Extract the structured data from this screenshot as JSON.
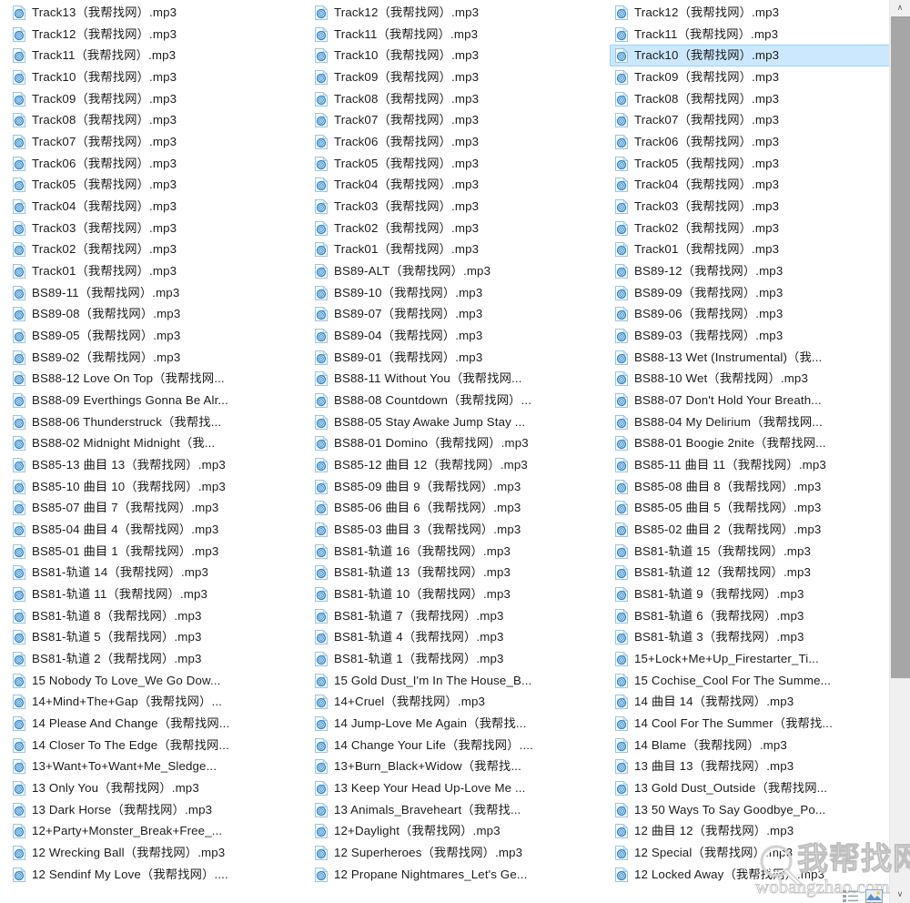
{
  "window": {
    "view_mode": "list",
    "accent_selection_color": "#cce8ff",
    "selection_border_color": "#99d1ff",
    "text_color": "#1c1c1c",
    "background_color": "#ffffff"
  },
  "scrollbar": {
    "up_arrow": "∧",
    "down_arrow": "∨",
    "thumb_color": "#a6a6a6",
    "track_color": "#f0f0f0"
  },
  "watermark": {
    "chinese_text": "我帮找网",
    "url_text": "wobangzhao.com"
  },
  "selected_file": "Track10（我帮找网）.mp3",
  "columns": [
    {
      "index": 1,
      "files": [
        "Track13（我帮找网）.mp3",
        "Track12（我帮找网）.mp3",
        "Track11（我帮找网）.mp3",
        "Track10（我帮找网）.mp3",
        "Track09（我帮找网）.mp3",
        "Track08（我帮找网）.mp3",
        "Track07（我帮找网）.mp3",
        "Track06（我帮找网）.mp3",
        "Track05（我帮找网）.mp3",
        "Track04（我帮找网）.mp3",
        "Track03（我帮找网）.mp3",
        "Track02（我帮找网）.mp3",
        "Track01（我帮找网）.mp3",
        "BS89-11（我帮找网）.mp3",
        "BS89-08（我帮找网）.mp3",
        "BS89-05（我帮找网）.mp3",
        "BS89-02（我帮找网）.mp3",
        "BS88-12 Love On Top（我帮找网...",
        "BS88-09 Everthings Gonna Be Alr...",
        "BS88-06 Thunderstruck（我帮找...",
        "BS88-02 Midnight Midnight（我...",
        "BS85-13 曲目 13（我帮找网）.mp3",
        "BS85-10 曲目 10（我帮找网）.mp3",
        "BS85-07 曲目 7（我帮找网）.mp3",
        "BS85-04 曲目 4（我帮找网）.mp3",
        "BS85-01 曲目 1（我帮找网）.mp3",
        "BS81-轨道 14（我帮找网）.mp3",
        "BS81-轨道 11（我帮找网）.mp3",
        "BS81-轨道 8（我帮找网）.mp3",
        "BS81-轨道 5（我帮找网）.mp3",
        "BS81-轨道 2（我帮找网）.mp3",
        "15 Nobody To Love_We Go Dow...",
        "14+Mind+The+Gap（我帮找网）...",
        "14 Please And Change（我帮找网...",
        "14 Closer To The Edge（我帮找网...",
        "13+Want+To+Want+Me_Sledge...",
        "13 Only You（我帮找网）.mp3",
        "13 Dark Horse（我帮找网）.mp3",
        "12+Party+Monster_Break+Free_...",
        "12 Wrecking Ball（我帮找网）.mp3",
        "12 Sendinf My Love（我帮找网）...."
      ]
    },
    {
      "index": 2,
      "files": [
        "Track12（我帮找网）.mp3",
        "Track11（我帮找网）.mp3",
        "Track10（我帮找网）.mp3",
        "Track09（我帮找网）.mp3",
        "Track08（我帮找网）.mp3",
        "Track07（我帮找网）.mp3",
        "Track06（我帮找网）.mp3",
        "Track05（我帮找网）.mp3",
        "Track04（我帮找网）.mp3",
        "Track03（我帮找网）.mp3",
        "Track02（我帮找网）.mp3",
        "Track01（我帮找网）.mp3",
        "BS89-ALT（我帮找网）.mp3",
        "BS89-10（我帮找网）.mp3",
        "BS89-07（我帮找网）.mp3",
        "BS89-04（我帮找网）.mp3",
        "BS89-01（我帮找网）.mp3",
        "BS88-11 Without You（我帮找网...",
        "BS88-08 Countdown（我帮找网）...",
        "BS88-05 Stay Awake Jump Stay ...",
        "BS88-01 Domino（我帮找网）.mp3",
        "BS85-12 曲目 12（我帮找网）.mp3",
        "BS85-09 曲目 9（我帮找网）.mp3",
        "BS85-06 曲目 6（我帮找网）.mp3",
        "BS85-03 曲目 3（我帮找网）.mp3",
        "BS81-轨道 16（我帮找网）.mp3",
        "BS81-轨道 13（我帮找网）.mp3",
        "BS81-轨道 10（我帮找网）.mp3",
        "BS81-轨道 7（我帮找网）.mp3",
        "BS81-轨道 4（我帮找网）.mp3",
        "BS81-轨道 1（我帮找网）.mp3",
        "15 Gold Dust_I'm In The House_B...",
        "14+Cruel（我帮找网）.mp3",
        "14 Jump-Love Me Again（我帮找...",
        "14 Change Your Life（我帮找网）....",
        "13+Burn_Black+Widow（我帮找...",
        "13 Keep Your Head Up-Love Me ...",
        "13 Animals_Braveheart（我帮找...",
        "12+Daylight（我帮找网）.mp3",
        "12 Superheroes（我帮找网）.mp3",
        "12 Propane Nightmares_Let's Ge..."
      ]
    },
    {
      "index": 3,
      "files": [
        "Track12（我帮找网）.mp3",
        "Track11（我帮找网）.mp3",
        "Track10（我帮找网）.mp3",
        "Track09（我帮找网）.mp3",
        "Track08（我帮找网）.mp3",
        "Track07（我帮找网）.mp3",
        "Track06（我帮找网）.mp3",
        "Track05（我帮找网）.mp3",
        "Track04（我帮找网）.mp3",
        "Track03（我帮找网）.mp3",
        "Track02（我帮找网）.mp3",
        "Track01（我帮找网）.mp3",
        "BS89-12（我帮找网）.mp3",
        "BS89-09（我帮找网）.mp3",
        "BS89-06（我帮找网）.mp3",
        "BS89-03（我帮找网）.mp3",
        "BS88-13 Wet (Instrumental)（我...",
        "BS88-10 Wet（我帮找网）.mp3",
        "BS88-07 Don't Hold Your Breath...",
        "BS88-04 My Delirium（我帮找网...",
        "BS88-01 Boogie 2nite（我帮找网...",
        "BS85-11 曲目 11（我帮找网）.mp3",
        "BS85-08 曲目 8（我帮找网）.mp3",
        "BS85-05 曲目 5（我帮找网）.mp3",
        "BS85-02 曲目 2（我帮找网）.mp3",
        "BS81-轨道 15（我帮找网）.mp3",
        "BS81-轨道 12（我帮找网）.mp3",
        "BS81-轨道 9（我帮找网）.mp3",
        "BS81-轨道 6（我帮找网）.mp3",
        "BS81-轨道 3（我帮找网）.mp3",
        "15+Lock+Me+Up_Firestarter_Ti...",
        "15 Cochise_Cool For The Summe...",
        "14 曲目 14（我帮找网）.mp3",
        "14 Cool For The Summer（我帮找...",
        "14 Blame（我帮找网）.mp3",
        "13 曲目 13（我帮找网）.mp3",
        "13 Gold Dust_Outside（我帮找网...",
        "13 50 Ways To Say Goodbye_Po...",
        "12 曲目 12（我帮找网）.mp3",
        "12 Special（我帮找网）.mp3",
        "12 Locked Away（我帮找网）.mp3"
      ]
    }
  ]
}
